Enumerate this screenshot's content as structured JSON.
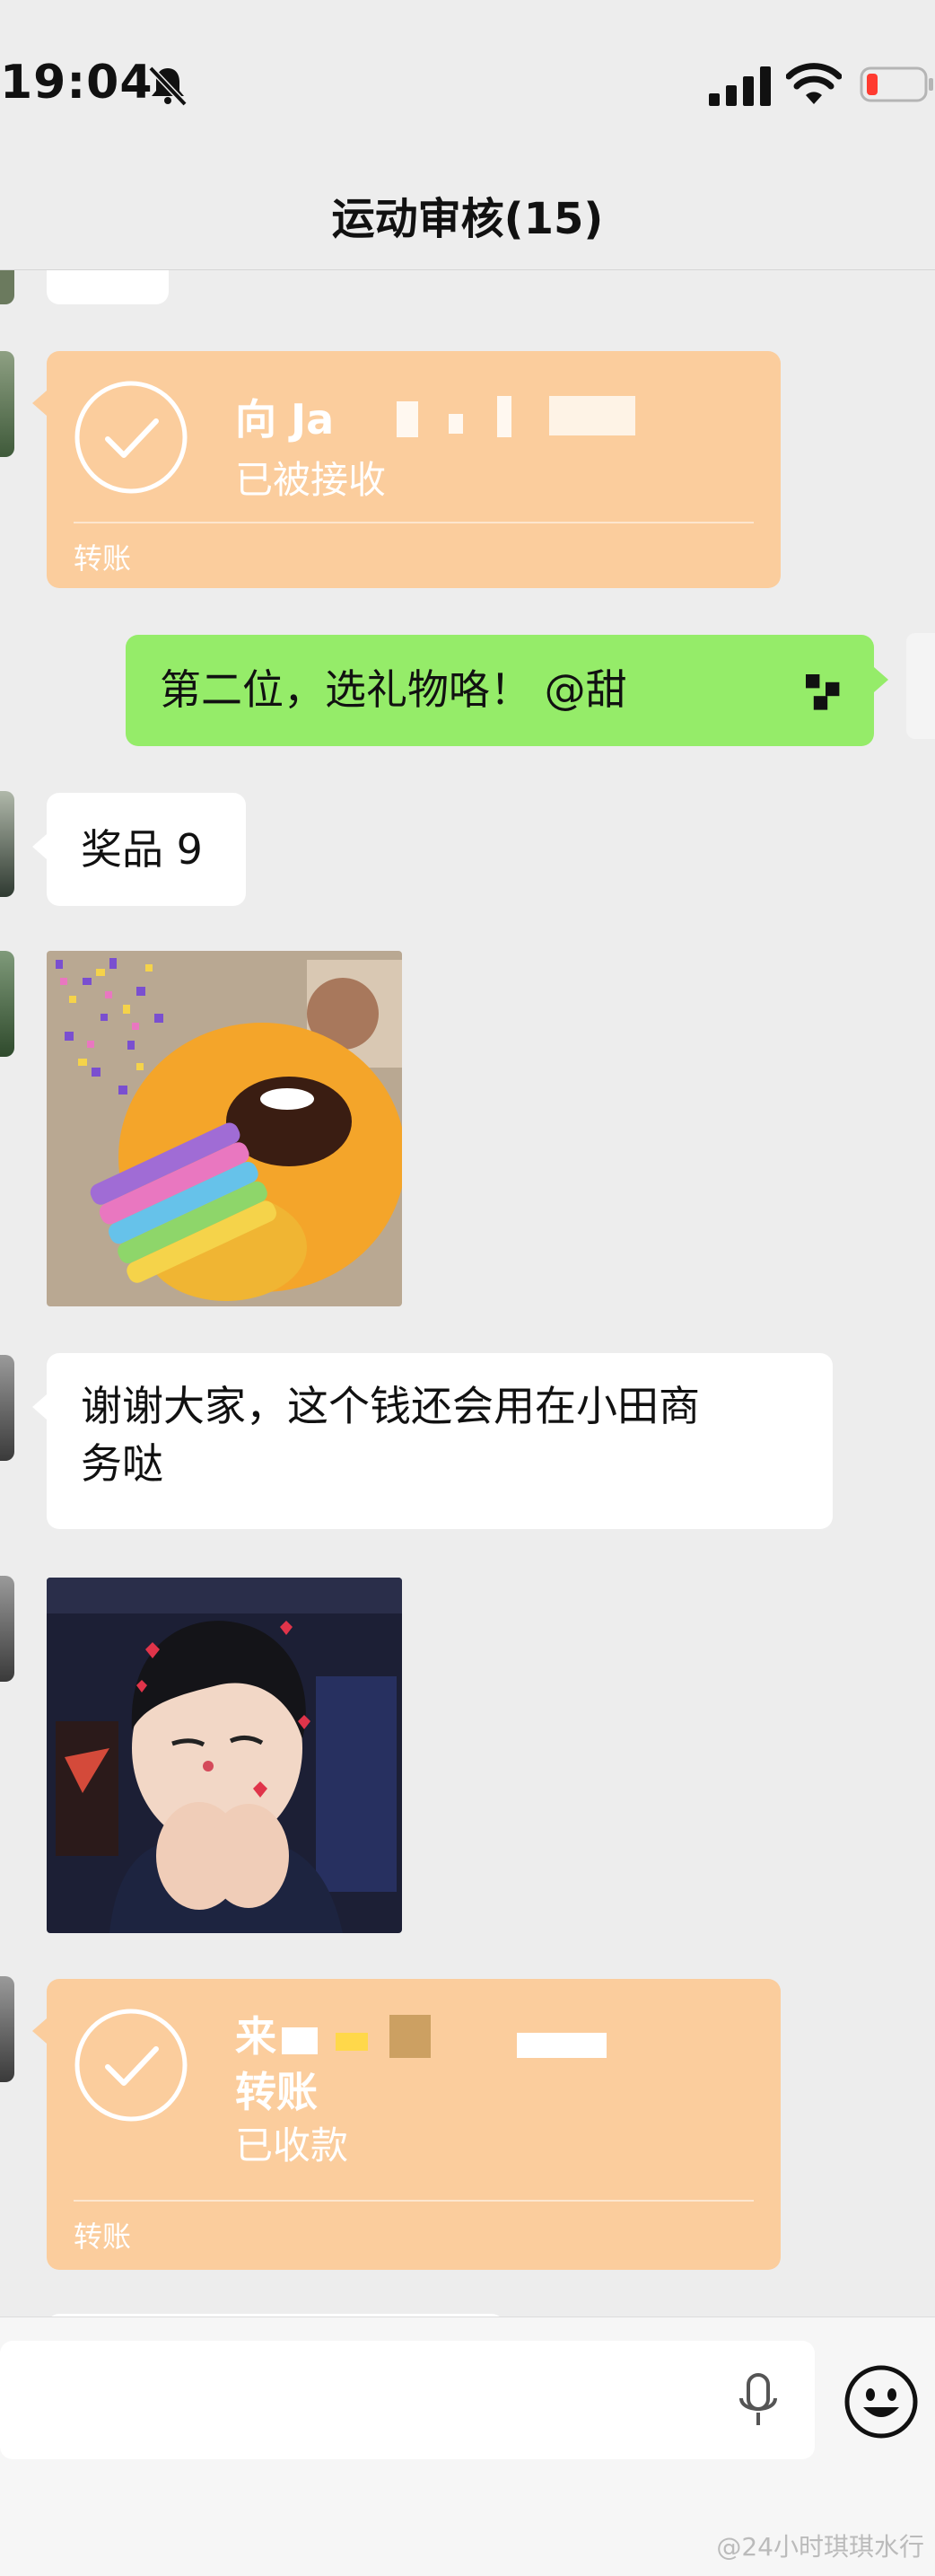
{
  "status": {
    "time": "19:04"
  },
  "nav": {
    "title": "运动审核(15)"
  },
  "messages": {
    "transfer1": {
      "to_prefix": "向 Ja",
      "status": "已被接收",
      "footer": "转账"
    },
    "sent_green": {
      "text": "第二位，选礼物咯！ @甜"
    },
    "prize": {
      "text": "奖品 9"
    },
    "thanks": {
      "line1": "谢谢大家，这个钱还会用在小田商",
      "line2": "务哒"
    },
    "transfer2": {
      "name_prefix": "来",
      "title": "转账",
      "status": "已收款",
      "footer": "转账"
    }
  },
  "input": {
    "placeholder": ""
  },
  "watermark": {
    "text": "@24小时琪琪水行"
  },
  "colors": {
    "bg": "#ededed",
    "green_bubble": "#95ec69",
    "transfer_orange": "#fbcd9d"
  },
  "icons": [
    "bell-slash-icon",
    "signal-icon",
    "wifi-icon",
    "battery-icon",
    "check-icon",
    "mic-icon",
    "emoji-icon"
  ]
}
